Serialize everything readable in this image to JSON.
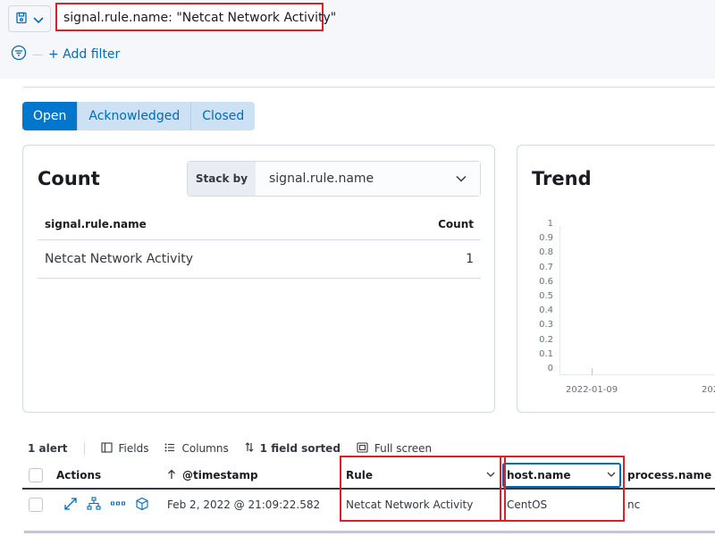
{
  "query_bar": {
    "query": "signal.rule.name: \"Netcat Network Activity\"",
    "add_filter": "+ Add filter"
  },
  "status_tabs": [
    {
      "label": "Open",
      "active": true
    },
    {
      "label": "Acknowledged",
      "active": false
    },
    {
      "label": "Closed",
      "active": false
    }
  ],
  "count_panel": {
    "title": "Count",
    "stack_by_label": "Stack by",
    "stack_by_value": "signal.rule.name",
    "columns": [
      "signal.rule.name",
      "Count"
    ],
    "rows": [
      {
        "name": "Netcat Network Activity",
        "count": "1"
      }
    ]
  },
  "trend_panel": {
    "title": "Trend",
    "chart_data": {
      "type": "bar",
      "y_ticks": [
        "1",
        "0.9",
        "0.8",
        "0.7",
        "0.6",
        "0.5",
        "0.4",
        "0.3",
        "0.2",
        "0.1",
        "0"
      ],
      "x_ticks": [
        "2022-01-09",
        "202"
      ],
      "ylim": [
        0,
        1
      ]
    }
  },
  "alerts_toolbar": {
    "count": "1 alert",
    "fields": "Fields",
    "columns": "Columns",
    "sorted": "1 field sorted",
    "fullscreen": "Full screen"
  },
  "alerts_table": {
    "headers": {
      "actions": "Actions",
      "timestamp": "@timestamp",
      "rule": "Rule",
      "host": "host.name",
      "process": "process.name"
    },
    "rows": [
      {
        "timestamp": "Feb 2, 2022 @ 21:09:22.582",
        "rule": "Netcat Network Activity",
        "host": "CentOS",
        "process": "nc"
      }
    ]
  },
  "colors": {
    "accent": "#0077cc",
    "highlight": "#d1242f"
  }
}
